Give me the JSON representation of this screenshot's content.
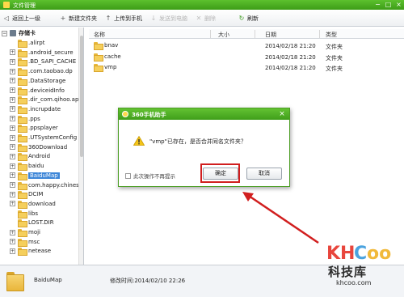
{
  "window": {
    "title": "文件管理",
    "controls": [
      "−",
      "□",
      "×"
    ]
  },
  "toolbar": {
    "back": "返回上一级",
    "new_folder": "新建文件夹",
    "upload": "上传到手机",
    "send_desktop": "发送到电脑",
    "delete": "删除",
    "refresh": "刷新"
  },
  "tree": {
    "root": "存储卡",
    "items": [
      {
        "label": ".alirpt",
        "expandable": false
      },
      {
        "label": ".android_secure",
        "expandable": true
      },
      {
        "label": ".BD_SAPI_CACHE",
        "expandable": true
      },
      {
        "label": ".com.taobao.dp",
        "expandable": true
      },
      {
        "label": ".DataStorage",
        "expandable": true
      },
      {
        "label": ".deviceidInfo",
        "expandable": true
      },
      {
        "label": ".dir_com.qihoo.ap",
        "expandable": true
      },
      {
        "label": ".incrupdate",
        "expandable": true
      },
      {
        "label": ".pps",
        "expandable": true
      },
      {
        "label": ".ppsplayer",
        "expandable": true
      },
      {
        "label": ".UTSystemConfig",
        "expandable": true
      },
      {
        "label": "360Download",
        "expandable": true
      },
      {
        "label": "Android",
        "expandable": true
      },
      {
        "label": "baidu",
        "expandable": true
      },
      {
        "label": "BaiduMap",
        "expandable": true,
        "selected": true
      },
      {
        "label": "com.happy.chines",
        "expandable": true
      },
      {
        "label": "DCIM",
        "expandable": true
      },
      {
        "label": "download",
        "expandable": true
      },
      {
        "label": "libs",
        "expandable": false
      },
      {
        "label": "LOST.DIR",
        "expandable": false
      },
      {
        "label": "moji",
        "expandable": true
      },
      {
        "label": "msc",
        "expandable": true
      },
      {
        "label": "netease",
        "expandable": true
      }
    ]
  },
  "file_list": {
    "columns": {
      "name": "名称",
      "size": "大小",
      "date": "日期",
      "type": "类型"
    },
    "rows": [
      {
        "name": "bnav",
        "size": "",
        "date": "2014/02/18 21:20",
        "type": "文件夹"
      },
      {
        "name": "cache",
        "size": "",
        "date": "2014/02/18 21:20",
        "type": "文件夹"
      },
      {
        "name": "vmp",
        "size": "",
        "date": "2014/02/18 21:20",
        "type": "文件夹"
      }
    ]
  },
  "status": {
    "name": "BaiduMap",
    "modified": "修改时间:2014/02/10 22:26"
  },
  "dialog": {
    "title": "360手机助手",
    "message": "\"vmp\"已存在，是否合并同名文件夹？",
    "checkbox": "此次操作不再提示",
    "confirm": "确定",
    "cancel": "取消"
  },
  "annotation_color": "#d11e1e",
  "watermark": {
    "logo": "KHCoo",
    "text": "科技库",
    "url": "khcoo.com"
  }
}
